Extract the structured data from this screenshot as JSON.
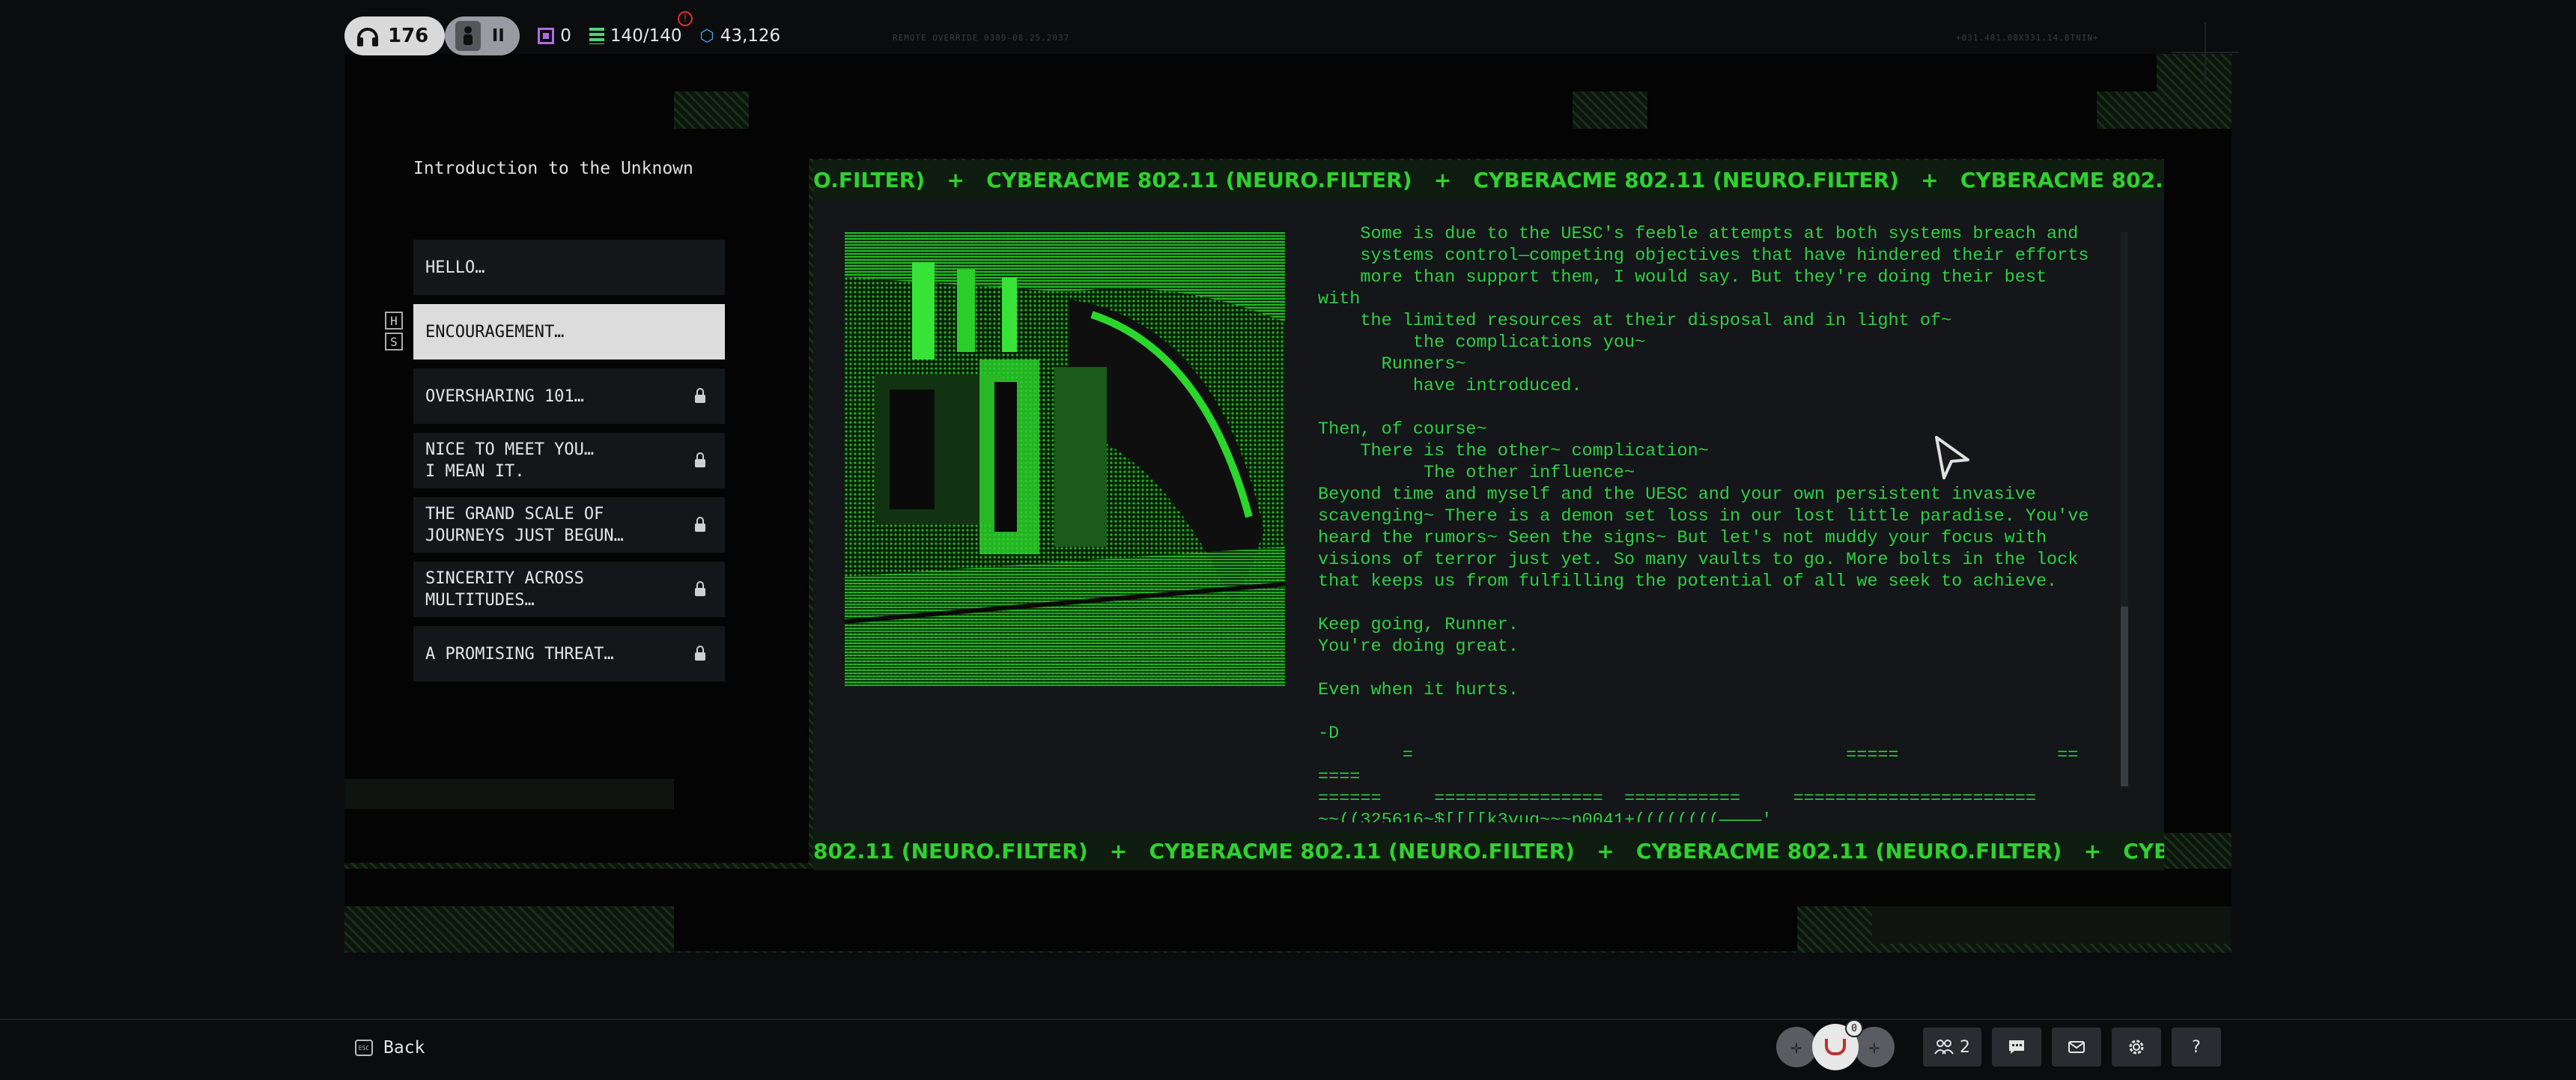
{
  "hud": {
    "avatar_count": "176",
    "mode_label": "II",
    "stat_purple": "0",
    "stat_stack": "140/140",
    "stat_credits": "43,126",
    "alert_symbol": "!",
    "faint_left": "REMOTE OVERRIDE 0389-08.25.2037",
    "faint_right": "+031.481.08X331.14.0TNIN+"
  },
  "menu": {
    "title": "Introduction to the Unknown",
    "hs_top": "H",
    "hs_bottom": "S",
    "items": [
      {
        "label": "HELLO…",
        "locked": false,
        "selected": false
      },
      {
        "label": "ENCOURAGEMENT…",
        "locked": false,
        "selected": true
      },
      {
        "label": "OVERSHARING 101…",
        "locked": true,
        "selected": false
      },
      {
        "label": "NICE TO MEET YOU…\nI MEAN IT.",
        "locked": true,
        "selected": false
      },
      {
        "label": "THE GRAND SCALE OF\nJOURNEYS JUST BEGUN…",
        "locked": true,
        "selected": false
      },
      {
        "label": "SINCERITY ACROSS\nMULTITUDES…",
        "locked": true,
        "selected": false
      },
      {
        "label": "A PROMISING THREAT…",
        "locked": true,
        "selected": false
      }
    ]
  },
  "ticker": {
    "top": "O.FILTER)   +   CYBERACME 802.11 (NEURO.FILTER)   +   CYBERACME 802.11 (NEURO.FILTER)   +   CYBERACME 802.11 (NEURO.FILTER)",
    "bottom": "802.11 (NEURO.FILTER)   +   CYBERACME 802.11 (NEURO.FILTER)   +   CYBERACME 802.11 (NEURO.FILTER)   +   CYBERACME 802.11"
  },
  "message": {
    "body": "    Some is due to the UESC's feeble attempts at both systems breach and\n    systems control—competing objectives that have hindered their efforts\n    more than support them, I would say. But they're doing their best\nwith\n    the limited resources at their disposal and in light of~\n         the complications you~\n      Runners~\n         have introduced.\n\nThen, of course~\n    There is the other~ complication~\n          The other influence~\nBeyond time and myself and the UESC and your own persistent invasive\nscavenging~ There is a demon set loss in our lost little paradise. You've\nheard the rumors~ Seen the signs~ But let's not muddy your focus with\nvisions of terror just yet. So many vaults to go. More bolts in the lock\nthat keeps us from fulfilling the potential of all we seek to achieve.\n\nKeep going, Runner.\nYou're doing great.\n\nEven when it hurts.\n\n-D\n        =                                         =====               ==\n====\n======     ================  ===========     =======================\n~~((325616~$[[[[k3vuq~~~p0041+((((((((————'"
  },
  "bottom": {
    "back_label": "Back",
    "esc_label": "ESC",
    "zoom_badge": "0",
    "party_count": "2",
    "help_label": "?"
  }
}
